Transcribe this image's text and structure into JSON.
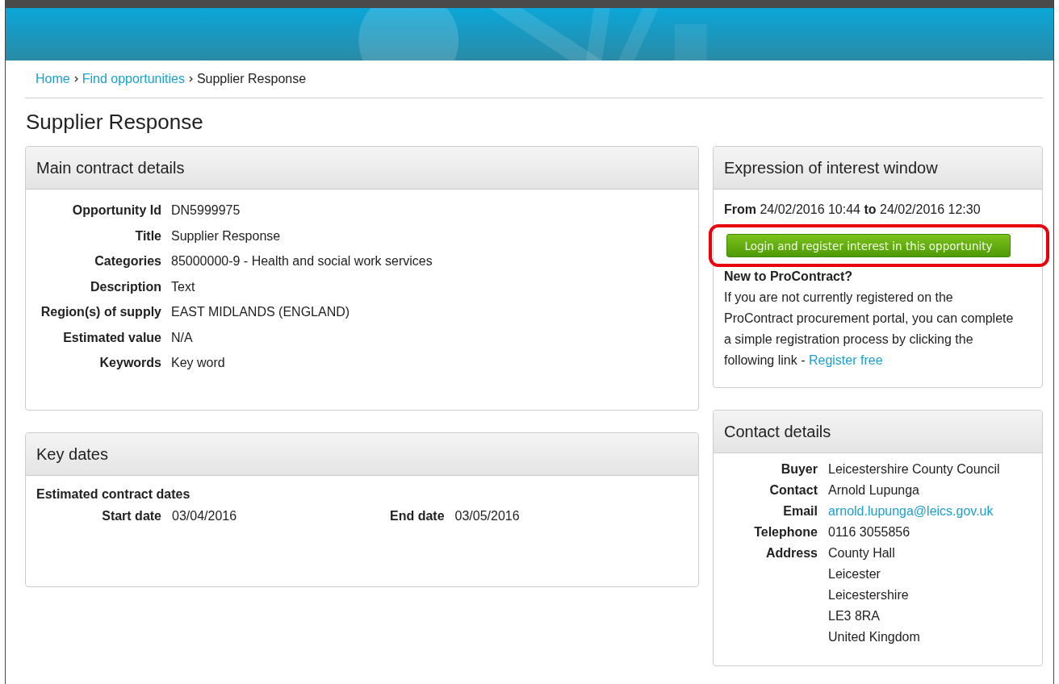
{
  "breadcrumb": [
    {
      "label": "Home",
      "kind": "link"
    },
    {
      "label": "Find opportunities",
      "kind": "link"
    },
    {
      "label": "Supplier Response",
      "kind": "current"
    }
  ],
  "page_title": "Supplier Response",
  "main_details": {
    "title": "Main contract details",
    "fields": [
      {
        "label": "Opportunity Id",
        "value": "DN5999975"
      },
      {
        "label": "Title",
        "value": "Supplier Response"
      },
      {
        "label": "Categories",
        "value": "85000000-9 - Health and social work services"
      },
      {
        "label": "Description",
        "value": "Text"
      },
      {
        "label": "Region(s) of supply",
        "value": "EAST MIDLANDS (ENGLAND)"
      },
      {
        "label": "Estimated value",
        "value": "N/A"
      },
      {
        "label": "Keywords",
        "value": "Key word"
      }
    ]
  },
  "key_dates": {
    "title": "Key dates",
    "subtitle": "Estimated contract dates",
    "dates": [
      {
        "label": "Start date",
        "value": "03/04/2016"
      },
      {
        "label": "End date",
        "value": "03/05/2016"
      }
    ]
  },
  "interest_window": {
    "title": "Expression of interest window",
    "period": "**From** 24/02/2016 10:44 **to** 24/02/2016 12:30",
    "button": "Login and register interest in this opportunity",
    "highlighted": true,
    "new_heading": "New to ProContract?",
    "text": "If you are not currently registered on the ProContract procurement portal, you can complete a simple registration process by clicking the following link - ",
    "link": "Register free"
  },
  "contact": {
    "title": "Contact details",
    "fields": [
      {
        "label": "Buyer",
        "lines": [
          "Leicestershire County Council"
        ],
        "kind": "text"
      },
      {
        "label": "Contact",
        "lines": [
          "Arnold Lupunga"
        ],
        "kind": "text"
      },
      {
        "label": "Email",
        "lines": [
          "arnold.lupunga@leics.gov.uk"
        ],
        "kind": "link"
      },
      {
        "label": "Telephone",
        "lines": [
          "0116 3055856"
        ],
        "kind": "text"
      },
      {
        "label": "Address",
        "lines": [
          "County Hall",
          "Leicester",
          "Leicestershire",
          "LE3 8RA",
          "United Kingdom"
        ],
        "kind": "text"
      }
    ]
  }
}
